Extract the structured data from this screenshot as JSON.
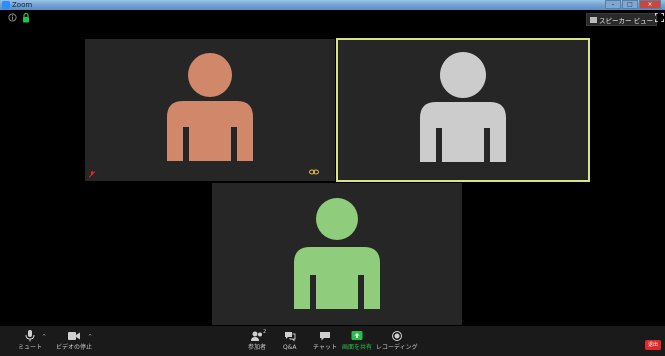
{
  "window": {
    "title": "Zoom"
  },
  "top_bar": {
    "speaker_view_label": "スピーカー ビュー"
  },
  "participants": [
    {
      "color": "#d1876a",
      "muted": true,
      "pinned": true
    },
    {
      "color": "#cccccc",
      "active_speaker": true
    },
    {
      "color": "#8fcc7b"
    }
  ],
  "toolbar": {
    "mute_label": "ミュート",
    "video_label": "ビデオの停止",
    "participants_label": "参加者",
    "participants_count": "2",
    "qa_label": "Q&A",
    "chat_label": "チャット",
    "share_label": "画面を共有",
    "record_label": "レコーディング",
    "end_label": "退出"
  },
  "colors": {
    "accent_green": "#24c14a",
    "active_border": "#d9e38a",
    "end_red": "#e02828"
  }
}
